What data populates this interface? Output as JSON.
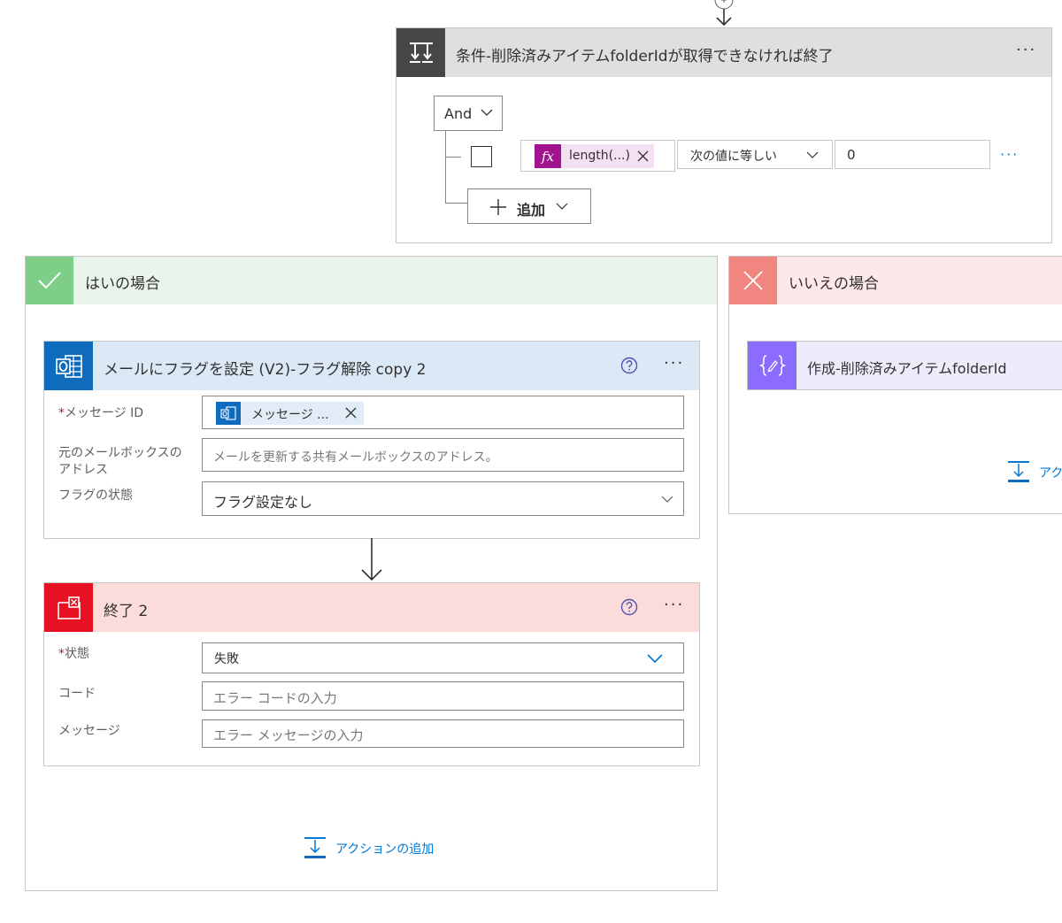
{
  "condition": {
    "title": "条件-削除済みアイテムfolderIdが取得できなければ終了",
    "group_operator": "And",
    "row": {
      "expression_token": "length(...)",
      "operator": "次の値に等しい",
      "value": "0"
    },
    "add_label": "追加"
  },
  "yes_branch": {
    "title": "はいの場合",
    "flag_action": {
      "title": "メールにフラグを設定 (V2)-フラグ解除 copy 2",
      "fields": {
        "message_id_label": "メッセージ ID",
        "message_id_token": "メッセージ ...",
        "mailbox_label": "元のメールボックスのアドレス",
        "mailbox_placeholder": "メールを更新する共有メールボックスのアドレス。",
        "flag_status_label": "フラグの状態",
        "flag_status_value": "フラグ設定なし"
      }
    },
    "terminate_action": {
      "title": "終了 2",
      "fields": {
        "status_label": "状態",
        "status_value": "失敗",
        "code_label": "コード",
        "code_placeholder": "エラー コードの入力",
        "message_label": "メッセージ",
        "message_placeholder": "エラー メッセージの入力"
      }
    },
    "add_action_label": "アクションの追加"
  },
  "no_branch": {
    "title": "いいえの場合",
    "compose_action": {
      "title": "作成-削除済みアイテムfolderId"
    },
    "add_action_label": "アク"
  },
  "required_marker": "*",
  "more_symbol": "···",
  "colors": {
    "accent": "#0078d4",
    "condition_header": "#484644",
    "yes_header": "#7fce87",
    "no_header": "#f1857f",
    "outlook": "#0f6cbd",
    "terminate": "#e81123",
    "compose": "#8c6cff",
    "fx": "#a1138f"
  },
  "icons": {
    "condition": "condition-icon",
    "check": "check-icon",
    "close": "x-icon",
    "outlook": "outlook-icon",
    "terminate": "terminate-icon",
    "compose": "compose-icon",
    "help": "help-icon",
    "add_action": "add-action-icon"
  }
}
